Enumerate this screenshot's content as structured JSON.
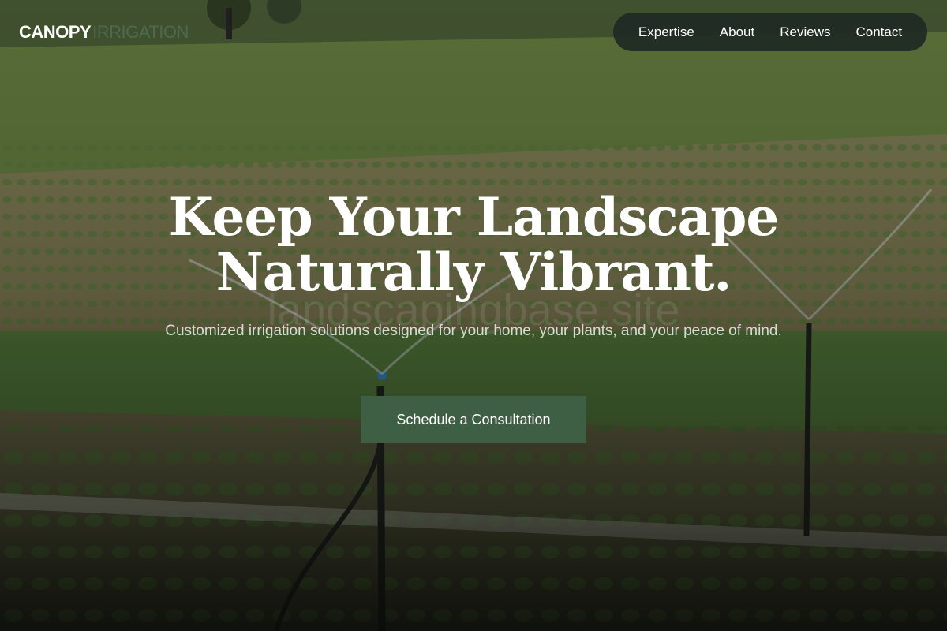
{
  "brand": {
    "name": "CANOPY",
    "accent": "IRRIGATION",
    "accent_color": "#4b6b4e"
  },
  "nav": {
    "items": [
      {
        "label": "Expertise"
      },
      {
        "label": "About"
      },
      {
        "label": "Reviews"
      },
      {
        "label": "Contact"
      }
    ]
  },
  "hero": {
    "headline_line1": "Keep Your Landscape",
    "headline_line2": "Naturally Vibrant.",
    "watermark": "landscapingbase.site",
    "subtitle": "Customized irrigation solutions designed for your home, your plants, and your peace of mind.",
    "cta_label": "Schedule a Consultation",
    "cta_color": "#3f5f44",
    "background_image": "field-sprinkler-photo"
  }
}
